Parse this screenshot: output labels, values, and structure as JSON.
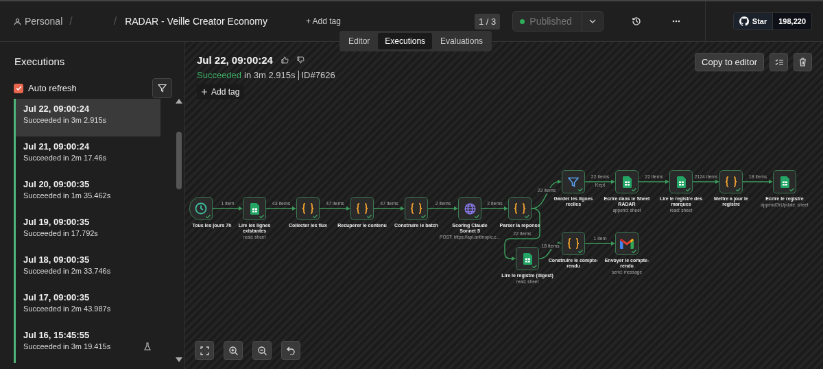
{
  "header": {
    "breadcrumb": [
      {
        "label": "Personal"
      },
      {
        "label": "/"
      },
      {
        "label": "/"
      }
    ],
    "title": "RADAR - Veille Creator Economy",
    "add_tag": "+ Add tag",
    "version": "1 / 3",
    "publish": {
      "label": "Published",
      "active": true
    },
    "github": {
      "label": "Star",
      "count": "198,220"
    }
  },
  "tabs": [
    {
      "label": "Editor",
      "selected": false
    },
    {
      "label": "Executions",
      "selected": true
    },
    {
      "label": "Evaluations",
      "selected": false
    }
  ],
  "sidebar": {
    "title": "Executions",
    "auto_refresh": {
      "label": "Auto refresh",
      "checked": true
    },
    "items": [
      {
        "date": "Jul 22, 09:00:24",
        "status": "Succeeded in 3m 2.915s",
        "selected": true,
        "test": false
      },
      {
        "date": "Jul 21, 09:00:24",
        "status": "Succeeded in 2m 17.46s",
        "selected": false,
        "test": false
      },
      {
        "date": "Jul 20, 09:00:35",
        "status": "Succeeded in 1m 35.462s",
        "selected": false,
        "test": false
      },
      {
        "date": "Jul 19, 09:00:35",
        "status": "Succeeded in 17.792s",
        "selected": false,
        "test": false
      },
      {
        "date": "Jul 18, 09:00:35",
        "status": "Succeeded in 2m 33.746s",
        "selected": false,
        "test": false
      },
      {
        "date": "Jul 17, 09:00:35",
        "status": "Succeeded in 2m 43.987s",
        "selected": false,
        "test": false
      },
      {
        "date": "Jul 16, 15:45:55",
        "status": "Succeeded in 3m 19.415s",
        "selected": false,
        "test": true
      }
    ]
  },
  "execution": {
    "title": "Jul 22, 09:00:24",
    "status": "Succeeded",
    "duration": "in 3m 2.915s",
    "id": "ID#7626",
    "add_tag": "Add tag",
    "copy_button": "Copy to editor"
  },
  "workflow": {
    "nodes": [
      {
        "label": "Tous les jours 7h",
        "kind": "trigger",
        "succeeded": true
      },
      {
        "label": "Lire les lignes existantes",
        "sublabel": "read: sheet",
        "kind": "sheet",
        "succeeded": true
      },
      {
        "label": "Collecter les flux",
        "kind": "code",
        "succeeded": true
      },
      {
        "label": "Recuperer le contenu",
        "kind": "code",
        "succeeded": true
      },
      {
        "label": "Construire le batch",
        "kind": "code",
        "succeeded": true
      },
      {
        "label": "Scoring Claude Sonnet 5",
        "sublabel": "POST: https://api.anthropic.c...",
        "kind": "http",
        "succeeded": true
      },
      {
        "label": "Parser la reponse",
        "kind": "code",
        "succeeded": true
      },
      {
        "label": "Garder les lignes reelles",
        "kind": "filter",
        "succeeded": true
      },
      {
        "label": "Ecrire dans le Sheet RADAR",
        "sublabel": "append: sheet",
        "kind": "sheet",
        "succeeded": true
      },
      {
        "label": "Lire le registre des marques",
        "sublabel": "read: sheet",
        "kind": "sheet",
        "succeeded": true
      },
      {
        "label": "Mettre a jour le registre",
        "kind": "code",
        "succeeded": true
      },
      {
        "label": "Ecrire le registre",
        "sublabel": "appendOrUpdate: sheet",
        "kind": "sheet",
        "succeeded": true
      },
      {
        "label": "Lire le registre (digest)",
        "sublabel": "read: sheet",
        "kind": "sheet",
        "succeeded": true
      },
      {
        "label": "Construire le compte-rendu",
        "kind": "code",
        "succeeded": true
      },
      {
        "label": "Envoyer le compte-rendu",
        "sublabel": "send: message",
        "kind": "gmail",
        "succeeded": true
      }
    ],
    "edges": [
      {
        "label": "1 item"
      },
      {
        "label": "43 items"
      },
      {
        "label": "47 items"
      },
      {
        "label": "47 items"
      },
      {
        "label": "2 items"
      },
      {
        "label": "2 items"
      },
      {
        "label": "22 items"
      },
      {
        "label": "22 items",
        "branch": "Kept"
      },
      {
        "label": "22 items"
      },
      {
        "label": "2124 items"
      },
      {
        "label": "18 items"
      },
      {
        "label": "22 items"
      },
      {
        "label": "18 items"
      },
      {
        "label": "1 item"
      }
    ]
  }
}
